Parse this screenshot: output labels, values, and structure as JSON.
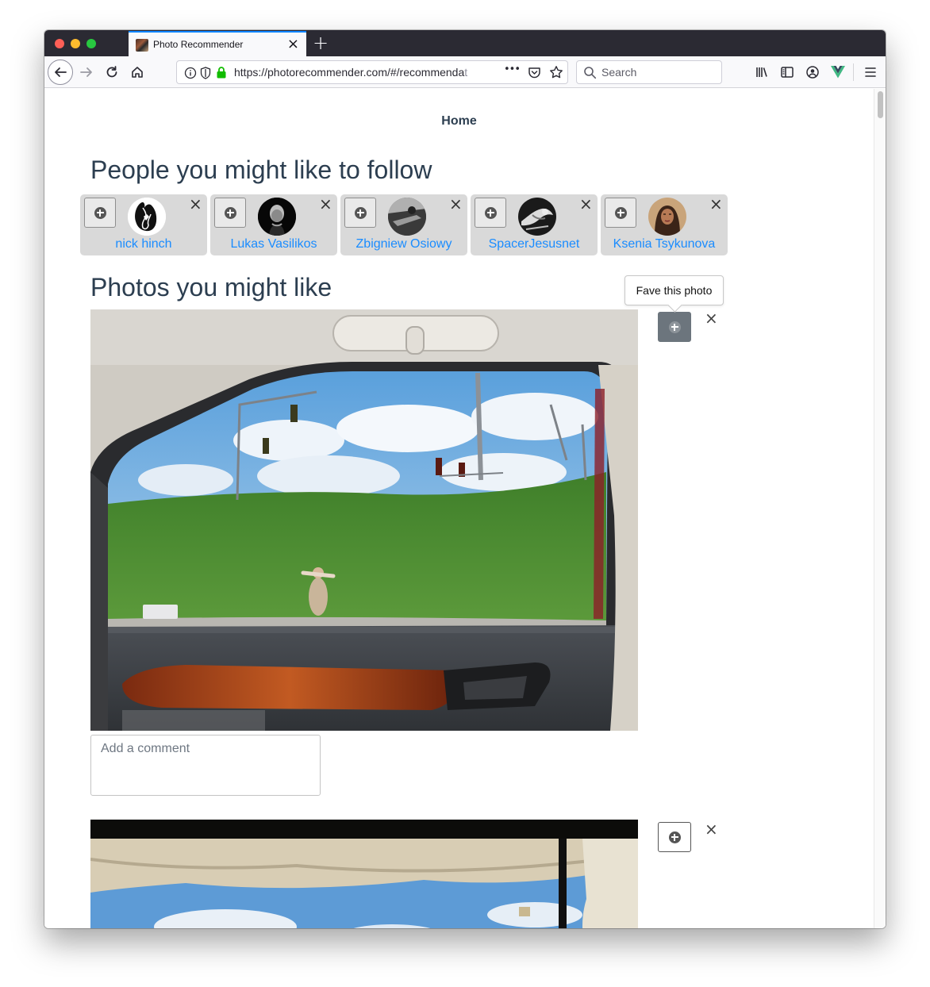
{
  "browser": {
    "tab_title": "Photo Recommender",
    "tab_close": "×",
    "new_tab": "+",
    "url_main": "https://photorecommender.com/#/recommenda",
    "url_faded": "t",
    "url_more": "•••",
    "search_placeholder": "Search"
  },
  "nav": {
    "home": "Home"
  },
  "people": {
    "heading": "People you might like to follow",
    "dismiss_glyph": "×",
    "items": [
      {
        "name": "nick hinch"
      },
      {
        "name": "Lukas Vasilikos"
      },
      {
        "name": "Zbigniew Osiowy"
      },
      {
        "name": "SpacerJesusnet"
      },
      {
        "name": "Ksenia Tsykunova"
      }
    ]
  },
  "photos": {
    "heading": "Photos you might like",
    "tooltip": "Fave this photo",
    "dismiss_glyph": "×",
    "comment_placeholder": "Add a comment"
  }
}
